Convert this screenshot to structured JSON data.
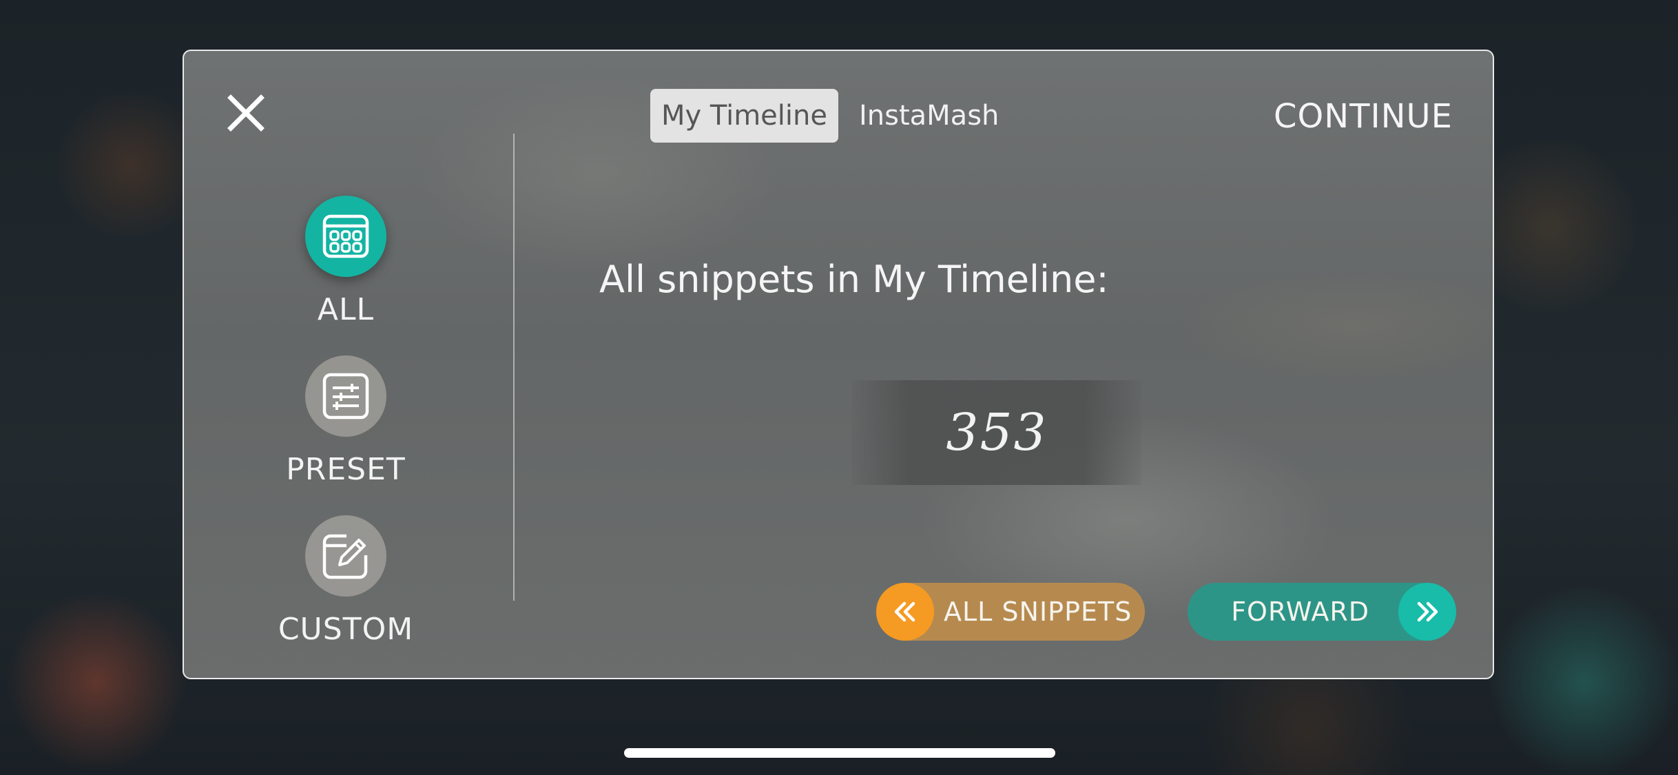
{
  "tabs": [
    {
      "label": "My Timeline",
      "active": true
    },
    {
      "label": "InstaMash",
      "active": false
    }
  ],
  "header": {
    "continue_label": "CONTINUE"
  },
  "sidebar": {
    "items": [
      {
        "label": "ALL",
        "icon": "calendar-grid-icon",
        "active": true
      },
      {
        "label": "PRESET",
        "icon": "sliders-icon",
        "active": false
      },
      {
        "label": "CUSTOM",
        "icon": "edit-pencil-icon",
        "active": false
      }
    ]
  },
  "main": {
    "headline": "All snippets in My Timeline:",
    "count": "353"
  },
  "buttons": {
    "back_label": "ALL SNIPPETS",
    "forward_label": "FORWARD"
  },
  "colors": {
    "accent_teal": "#14b4a3",
    "accent_orange": "#f59a22",
    "back_pill": "#b68a4f",
    "forward_pill": "#2d9587"
  }
}
